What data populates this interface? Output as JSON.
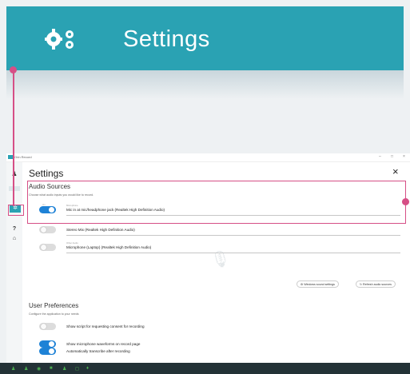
{
  "banner": {
    "title": "Settings",
    "icon": "gears-icon"
  },
  "window": {
    "app_name": "Orin Record",
    "controls": [
      "–",
      "□",
      "×"
    ]
  },
  "rail": {
    "items": [
      "gears-icon",
      "?",
      "home-icon"
    ]
  },
  "panel": {
    "title": "Settings",
    "close_label": "×",
    "audio": {
      "title": "Audio Sources",
      "description": "Choose what audio inputs you would like to record.",
      "sources": [
        {
          "caption": "Microphone",
          "name": "Mic in at mic/headphone jack (Realtek High Definition Audio)",
          "enabled": true
        },
        {
          "caption": "",
          "name": "Stereo Mix (Realtek High Definition Audio)",
          "enabled": false
        },
        {
          "caption": "Other Audio",
          "name": "Microphone (Laptop) (Realtek High Definition Audio)",
          "enabled": false
        }
      ],
      "windows_sound_settings": "⚙ Windows sound settings",
      "refresh_audio_sources": "↻ Refresh audio sources"
    },
    "preferences": {
      "title": "User Preferences",
      "description": "Configure the application to your needs",
      "items": [
        {
          "label": "Show script for requesting consent for recording",
          "enabled": false
        },
        {
          "label": "Show microphone waveforms on record page",
          "enabled": true
        },
        {
          "label": "Automatically transcribe after recording",
          "enabled": true
        }
      ]
    }
  },
  "colors": {
    "accent": "#2aa2b3",
    "toggle_on": "#1e82d6",
    "highlight": "#d64f86",
    "status_bar": "#233236"
  }
}
